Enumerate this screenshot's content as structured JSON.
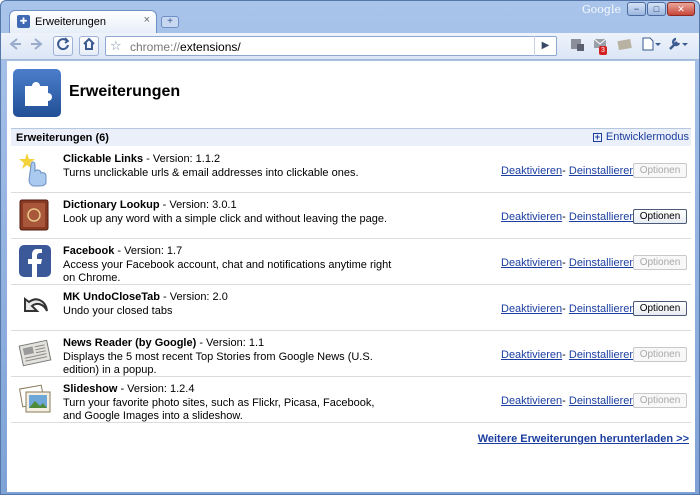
{
  "window": {
    "tab_title": "Erweiterungen",
    "tab_close": "×",
    "new_tab": "+",
    "brand": "Google",
    "controls": {
      "minimize": "−",
      "maximize": "□",
      "close": "✕"
    }
  },
  "toolbar": {
    "url_protocol": "chrome://",
    "url_path": "extensions/",
    "badge_count": "3"
  },
  "page": {
    "title": "Erweiterungen",
    "section_title": "Erweiterungen (6)",
    "dev_mode": "Entwicklermodus",
    "more_link": "Weitere Erweiterungen herunterladen >>"
  },
  "extensions": [
    {
      "name": "Clickable Links",
      "version": " - Version: 1.1.2",
      "description": "Turns unclickable urls & email addresses into clickable ones.",
      "disable": "Deaktivieren",
      "uninstall": "Deinstallieren",
      "options": "Optionen",
      "options_enabled": false,
      "icon": "hand-pointer-icon"
    },
    {
      "name": "Dictionary Lookup",
      "version": " - Version: 3.0.1",
      "description": "Look up any word with a simple click and without leaving the page.",
      "disable": "Deaktivieren",
      "uninstall": "Deinstallieren",
      "options": "Optionen",
      "options_enabled": true,
      "icon": "book-icon"
    },
    {
      "name": "Facebook",
      "version": " - Version: 1.7",
      "description": "Access your Facebook account, chat and notifications anytime right on Chrome.",
      "disable": "Deaktivieren",
      "uninstall": "Deinstallieren",
      "options": "Optionen",
      "options_enabled": false,
      "icon": "facebook-icon"
    },
    {
      "name": "MK UndoCloseTab",
      "version": " - Version: 2.0",
      "description": "Undo your closed tabs",
      "disable": "Deaktivieren",
      "uninstall": "Deinstallieren",
      "options": "Optionen",
      "options_enabled": true,
      "icon": "undo-arrow-icon"
    },
    {
      "name": "News Reader (by Google)",
      "version": " - Version: 1.1",
      "description": "Displays the 5 most recent Top Stories from Google News (U.S. edition) in a popup.",
      "disable": "Deaktivieren",
      "uninstall": "Deinstallieren",
      "options": "Optionen",
      "options_enabled": false,
      "icon": "newspaper-icon"
    },
    {
      "name": "Slideshow",
      "version": " - Version: 1.2.4",
      "description": "Turn your favorite photo sites, such as Flickr, Picasa, Facebook, and Google Images into a slideshow.",
      "disable": "Deaktivieren",
      "uninstall": "Deinstallieren",
      "options": "Optionen",
      "options_enabled": false,
      "icon": "photos-icon"
    }
  ],
  "colors": {
    "link": "#1b3ea0",
    "section_bg": "#ebeff9",
    "chrome_frame": "#7ea2d6"
  }
}
